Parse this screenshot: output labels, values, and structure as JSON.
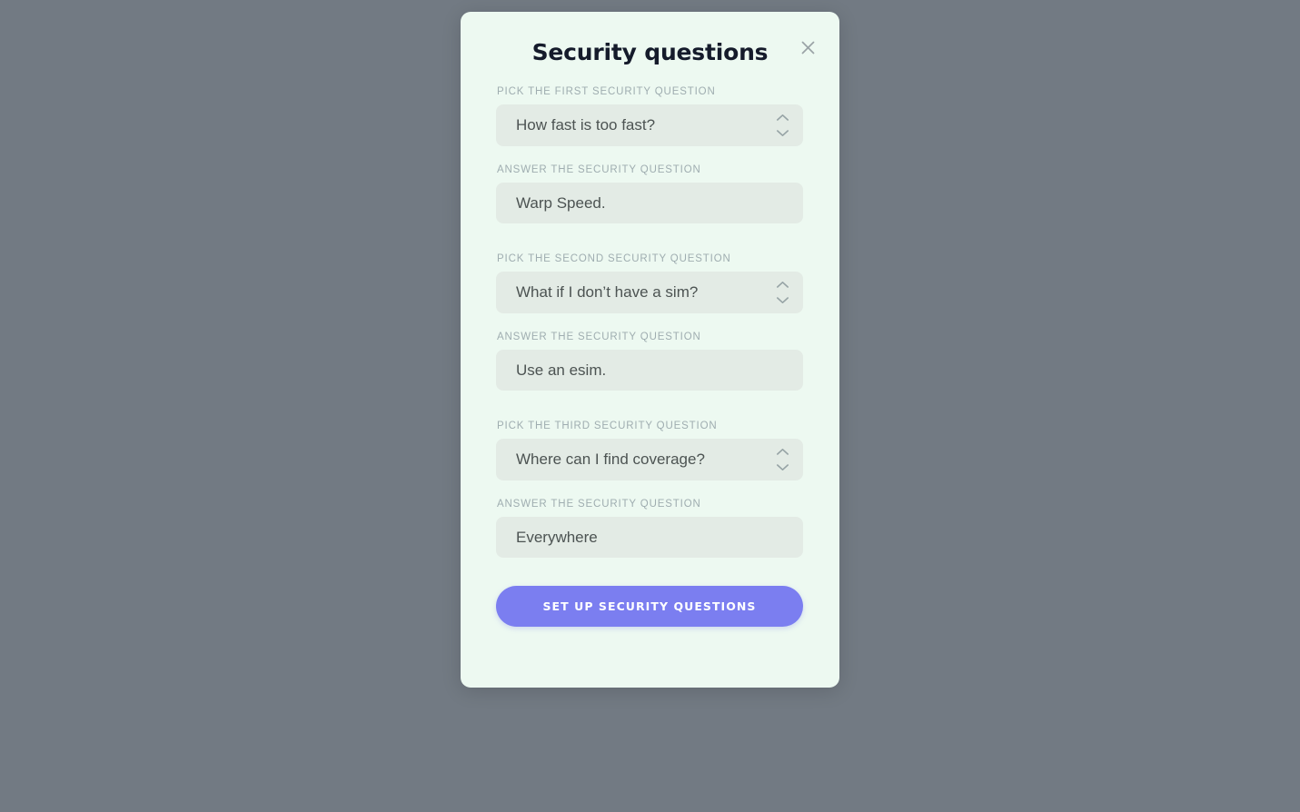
{
  "backdrop": {
    "color": "#727a83"
  },
  "modal": {
    "title": "Security questions",
    "background": "#edf9f1",
    "close_icon": "close-icon",
    "field_background": "#e3ebe5",
    "label_color": "#9fadb0",
    "value_color": "#4c5352",
    "title_color": "#151b2b"
  },
  "form": {
    "groups": [
      {
        "question_label": "PICK THE FIRST SECURITY QUESTION",
        "question_value": "How fast is too fast?",
        "answer_label": "ANSWER THE SECURITY QUESTION",
        "answer_value": "Warp Speed."
      },
      {
        "question_label": "PICK THE SECOND SECURITY QUESTION",
        "question_value": "What if I don’t have a sim?",
        "answer_label": "ANSWER THE SECURITY QUESTION",
        "answer_value": "Use an esim."
      },
      {
        "question_label": "PICK THE THIRD SECURITY QUESTION",
        "question_value": "Where can I find coverage?",
        "answer_label": "ANSWER THE SECURITY QUESTION",
        "answer_value": "Everywhere"
      }
    ],
    "stepper_icon": "chevron-up-down-icon",
    "submit": {
      "label": "Set up security questions",
      "color": "#7b7ef0",
      "text_color": "#ffffff"
    }
  }
}
